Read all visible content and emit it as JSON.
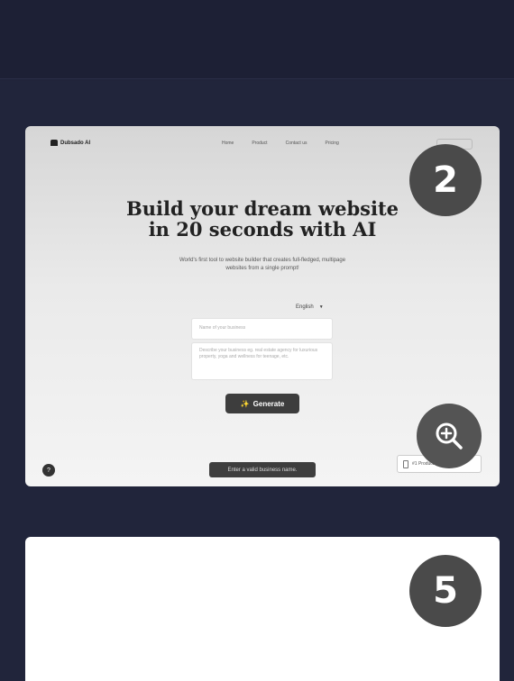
{
  "gallery": {
    "cards": [
      {
        "number": "2",
        "preview": {
          "logo": "Dubsado AI",
          "nav_links": [
            "Home",
            "Product",
            "Contact us",
            "Pricing"
          ],
          "hero_line1": "Build your dream website",
          "hero_line2": "in 20 seconds with AI",
          "subtitle": "World's first tool to website builder that creates full-fledged, multipage websites from a single prompt!",
          "language": "English",
          "name_placeholder": "Name of your business",
          "description_placeholder": "Describe your business eg. real estate agency for luxurious property, yoga and wellness for teenage, etc.",
          "generate_label": "Generate",
          "help_label": "?",
          "toast_text": "Enter a valid business name.",
          "promo_text": "#1 Product of the Day"
        }
      },
      {
        "number": "5"
      }
    ]
  },
  "colors": {
    "background": "#1f2238",
    "badge": "#4a4a4a",
    "zoom_button": "#545454"
  },
  "icons": {
    "zoom": "zoom-in-icon",
    "sparkle": "sparkle-icon"
  }
}
